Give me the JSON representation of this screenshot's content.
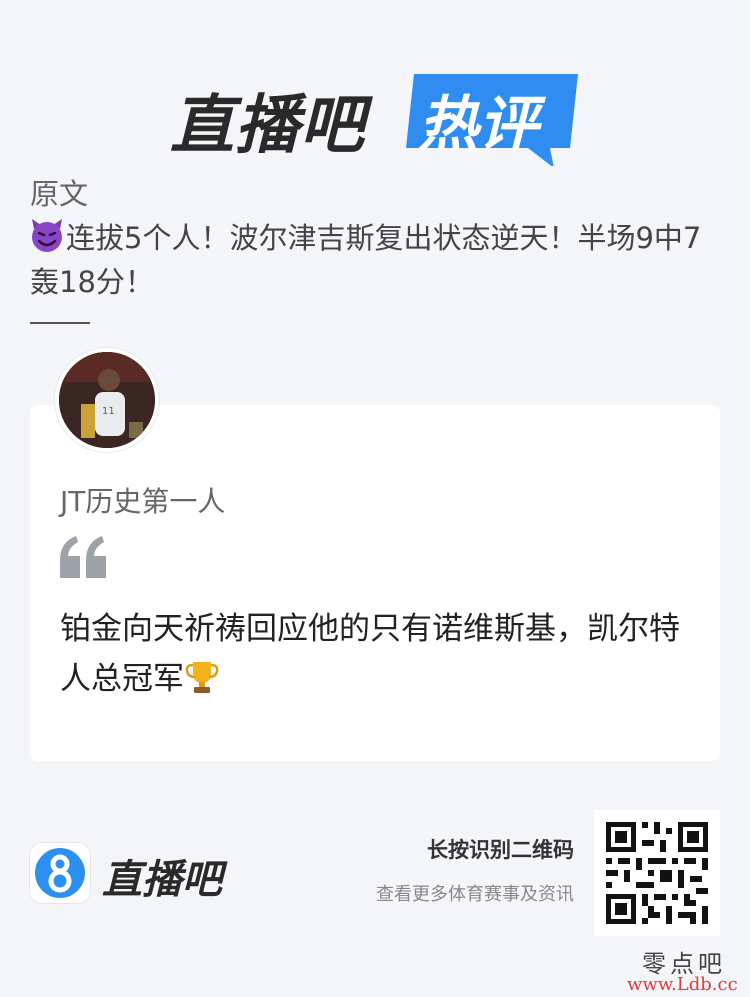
{
  "header": {
    "brand_main": "直播吧",
    "brand_badge": "热评",
    "badge_color": "#2f8cf0"
  },
  "original": {
    "label": "原文",
    "emoji_icon": "smiling-devil-icon",
    "title": "连拔5个人！波尔津吉斯复出状态逆天！半场9中7轰18分！"
  },
  "comment": {
    "username": "JT历史第一人",
    "avatar_icon": "user-avatar-photo",
    "text": "铂金向天祈祷回应他的只有诺维斯基，凯尔特人总冠军",
    "trailing_icon": "trophy-icon"
  },
  "footer": {
    "brand": "直播吧",
    "logo_icon": "number-8-logo-icon",
    "scan_title": "长按识别二维码",
    "scan_subtitle": "查看更多体育赛事及资讯",
    "qr_icon": "qr-code-icon"
  },
  "watermark": {
    "name": "零点吧",
    "url": "www.Ldb.cc",
    "url_color": "#e03a3a"
  }
}
